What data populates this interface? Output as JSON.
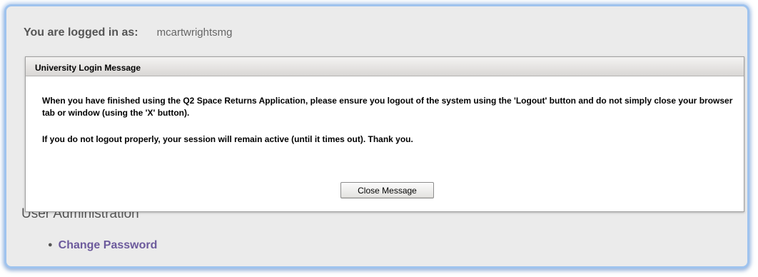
{
  "login": {
    "label": "You are logged in as:",
    "username": "mcartwrightsmg"
  },
  "dialog": {
    "title": "University Login Message",
    "paragraph1": "When you have finished using the Q2 Space Returns Application, please ensure you logout of the system using the 'Logout' button and do not simply close your browser tab or window (using the 'X' button).",
    "paragraph2": "If you do not logout properly, your session will remain active (until it times out). Thank you.",
    "close_button": "Close Message"
  },
  "user_admin": {
    "heading": "User Administration",
    "links": [
      {
        "label": "Change Password"
      }
    ]
  },
  "colors": {
    "frame_border": "#9fc3ee",
    "page_background": "#ebebeb",
    "link": "#6c5a9c"
  }
}
